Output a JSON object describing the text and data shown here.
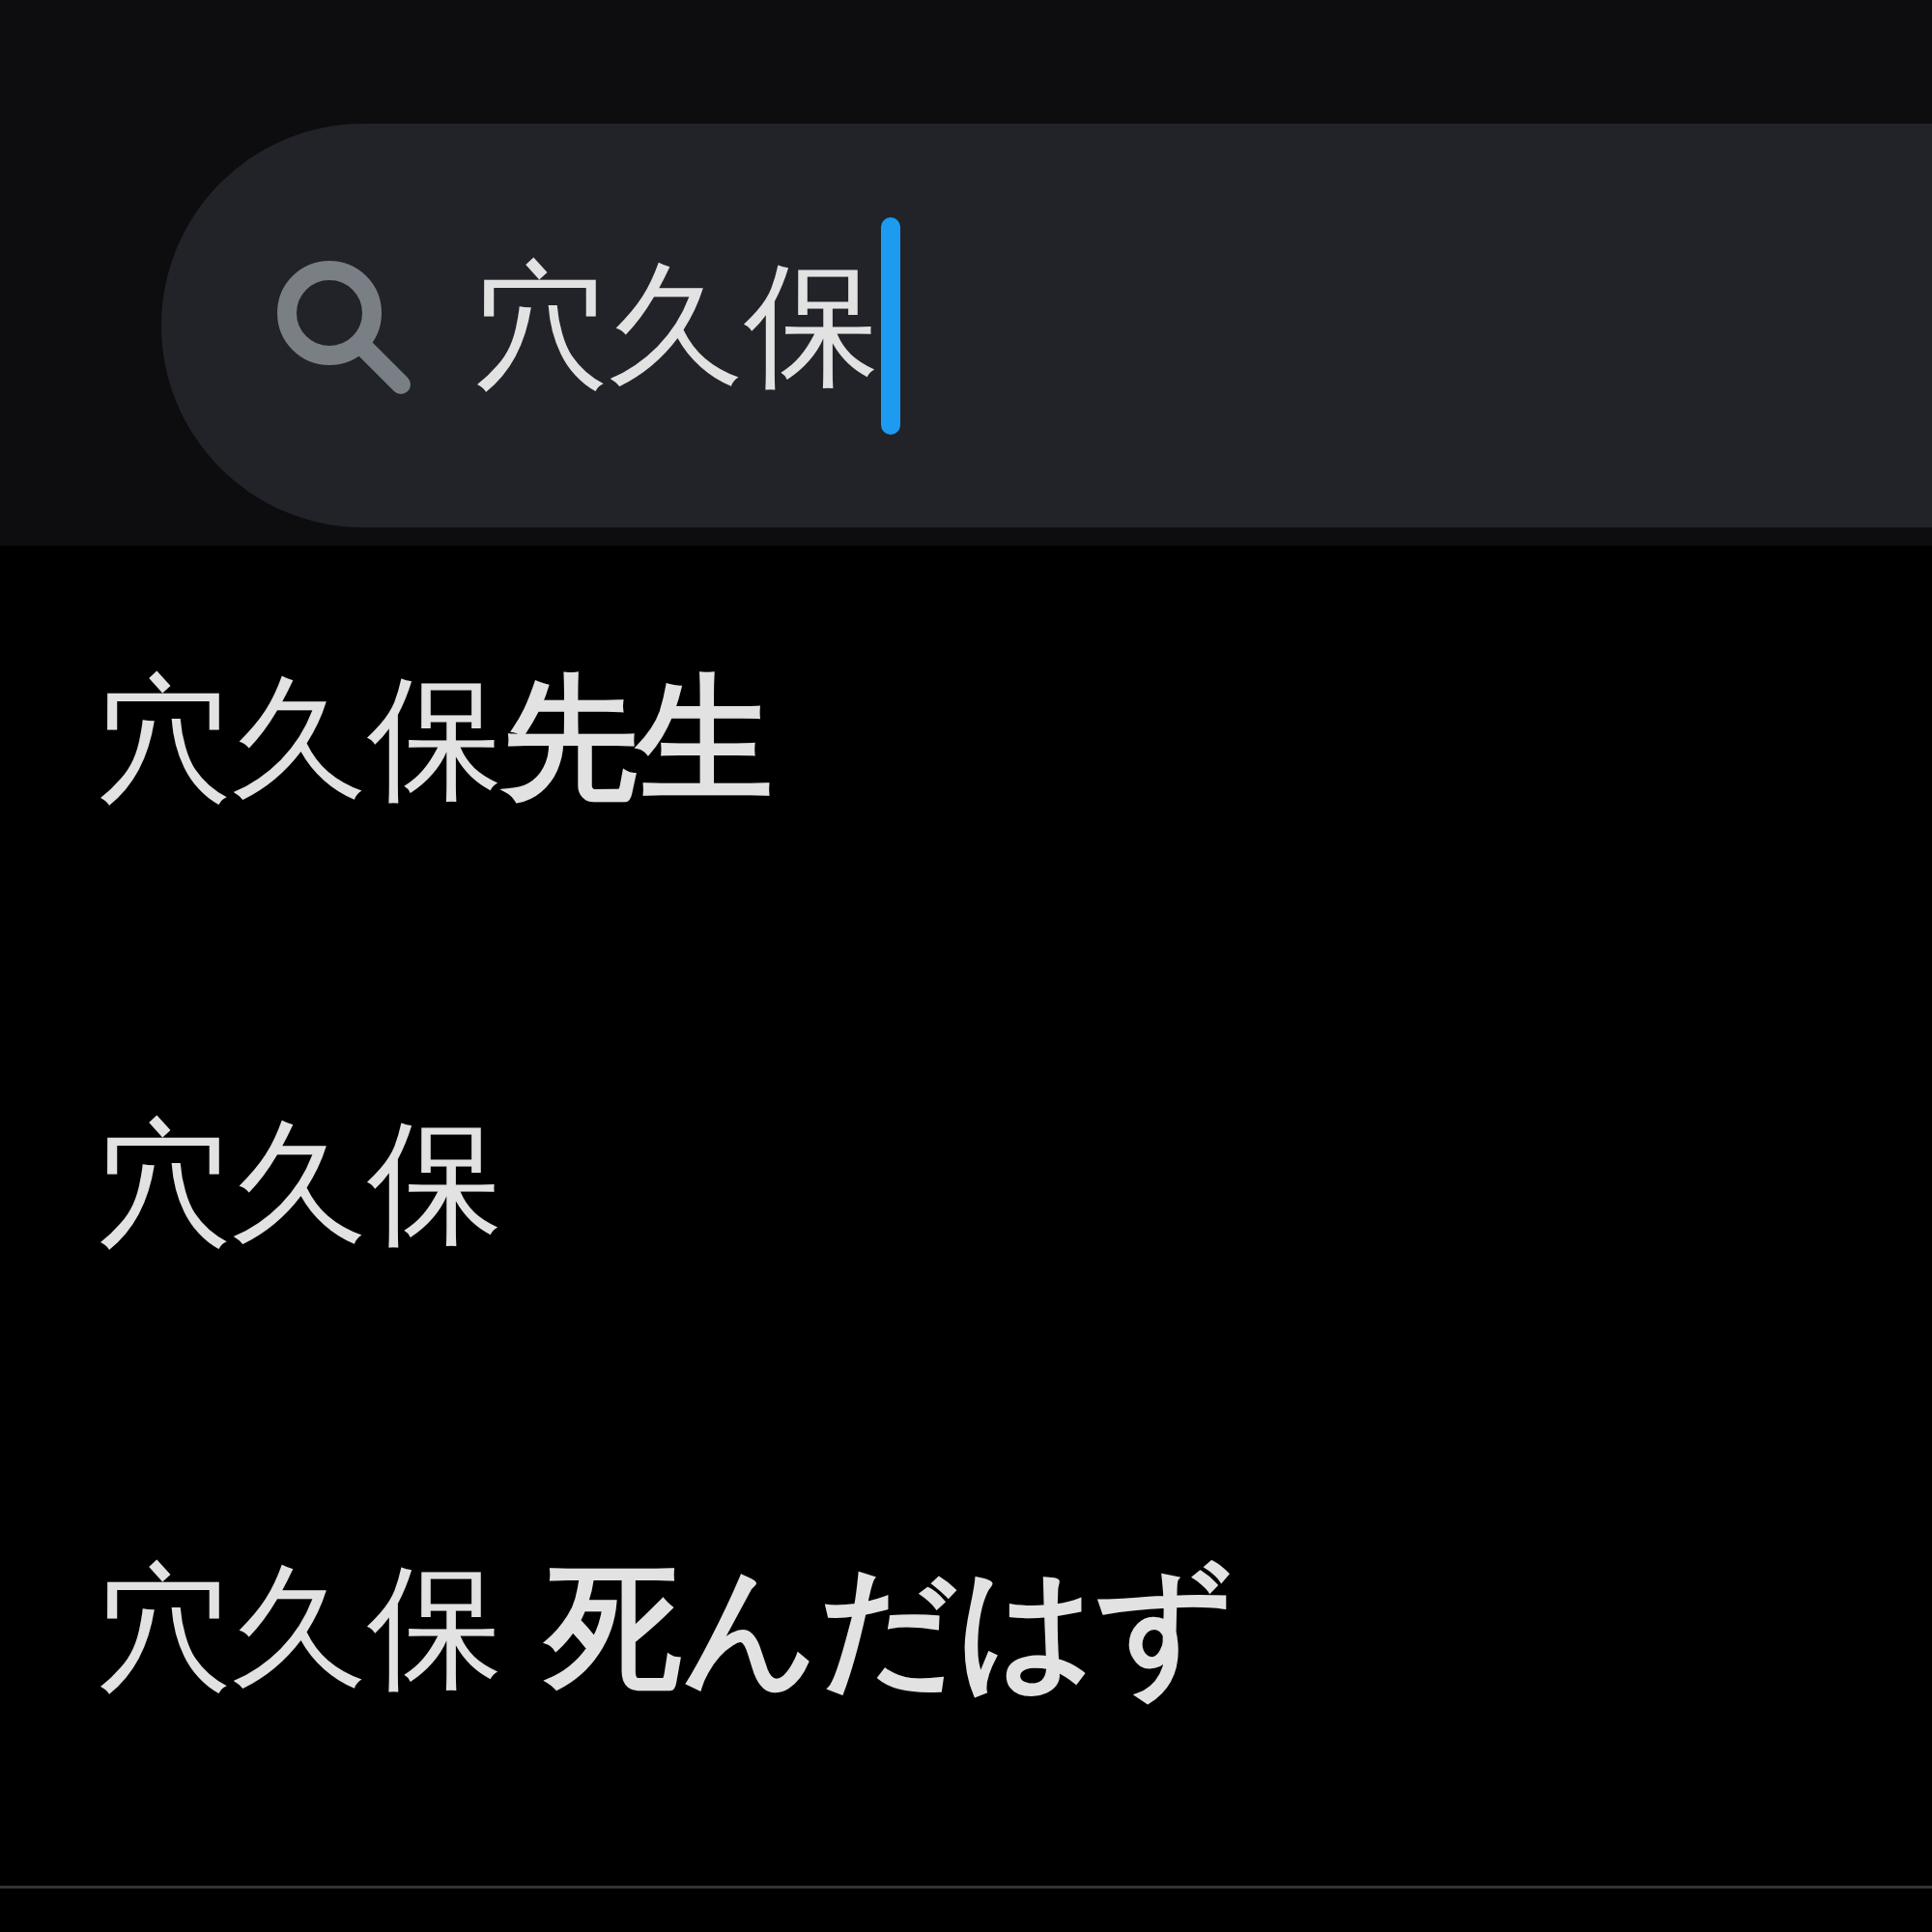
{
  "search": {
    "value": "穴久保"
  },
  "suggestions": [
    {
      "text": "穴久保**先生**"
    },
    {
      "text": "穴久保"
    },
    {
      "text": "穴久保 **死んだはず**"
    }
  ]
}
